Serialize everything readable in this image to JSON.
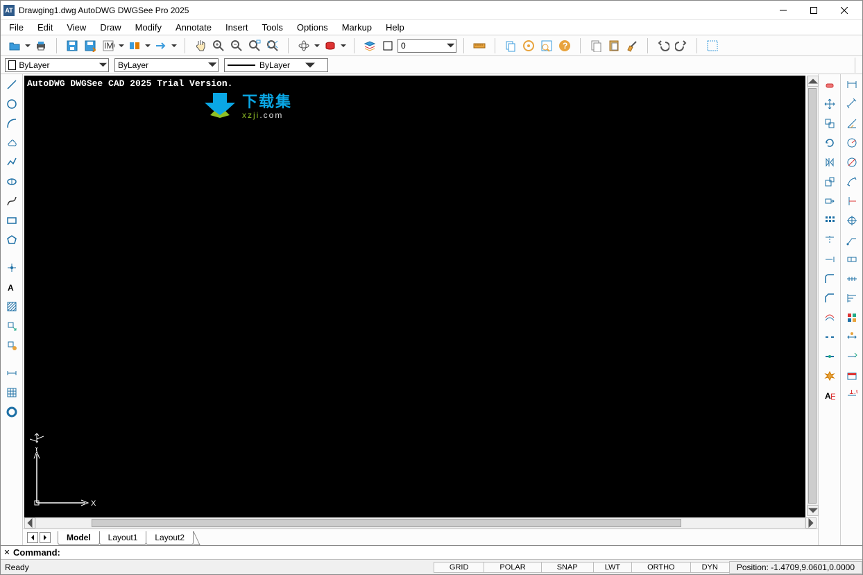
{
  "title": "Drawging1.dwg AutoDWG DWGSee Pro 2025",
  "app_icon_text": "AT",
  "menu": [
    "File",
    "Edit",
    "View",
    "Draw",
    "Modify",
    "Annotate",
    "Insert",
    "Tools",
    "Options",
    "Markup",
    "Help"
  ],
  "toolbar": {
    "layer_value": "0"
  },
  "layerbar": {
    "color_layer": "ByLayer",
    "ltype": "ByLayer",
    "lweight": "ByLayer"
  },
  "canvas": {
    "watermark": "AutoDWG DWGSee CAD 2025 Trial Version.",
    "brand_cn": "下载集",
    "brand_sub_a": "xzji",
    "brand_sub_b": ".com",
    "axis_x": "X",
    "axis_y": "Y"
  },
  "tabs": {
    "model": "Model",
    "layout1": "Layout1",
    "layout2": "Layout2"
  },
  "cmd": {
    "label": "Command:"
  },
  "status": {
    "ready": "Ready",
    "grid": "GRID",
    "polar": "POLAR",
    "snap": "SNAP",
    "lwt": "LWT",
    "ortho": "ORTHO",
    "dyn": "DYN",
    "position": "Position: -1.4709,9.0601,0.0000"
  }
}
